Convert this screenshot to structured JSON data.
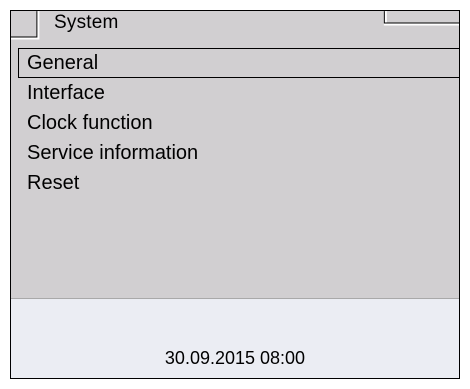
{
  "tab": {
    "title": "System"
  },
  "menu": {
    "items": [
      {
        "label": "General",
        "selected": true
      },
      {
        "label": "Interface",
        "selected": false
      },
      {
        "label": "Clock function",
        "selected": false
      },
      {
        "label": "Service information",
        "selected": false
      },
      {
        "label": "Reset",
        "selected": false
      }
    ]
  },
  "status": {
    "datetime": "30.09.2015 08:00"
  },
  "colors": {
    "menu_background": "#d1cfd1",
    "status_background": "#ebedf3",
    "border": "#000000"
  }
}
